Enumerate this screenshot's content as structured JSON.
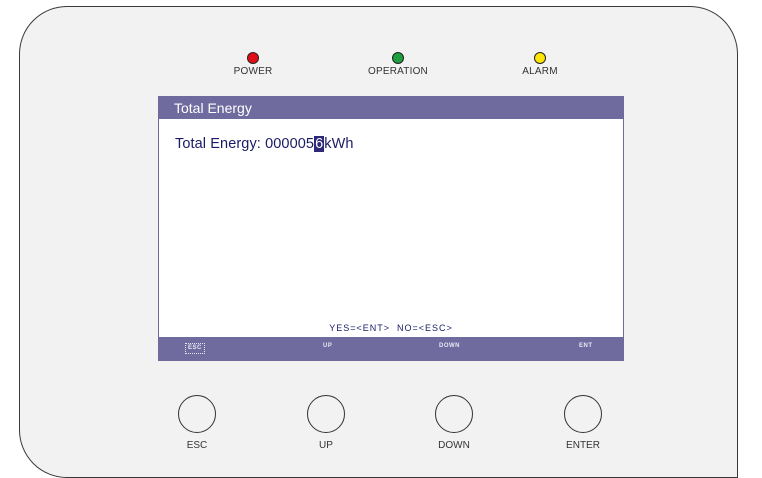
{
  "indicators": [
    {
      "label": "POWER",
      "color": "#e10f16"
    },
    {
      "label": "OPERATION",
      "color": "#1e9e3c"
    },
    {
      "label": "ALARM",
      "color": "#ffe600"
    }
  ],
  "screen": {
    "title": "Total Energy",
    "energy_label": "Total Energy:",
    "energy_value_prefix": "00000",
    "energy_value_cursor": "5",
    "energy_value_suffix": "6",
    "energy_unit": "kWh",
    "confirm_text": "YES=<ENT>  NO=<ESC>",
    "softkeys": {
      "esc": "ESC",
      "up": "UP",
      "down": "DOWN",
      "ent": "ENT"
    }
  },
  "buttons": {
    "esc": "ESC",
    "up": "UP",
    "down": "DOWN",
    "enter": "ENTER"
  }
}
